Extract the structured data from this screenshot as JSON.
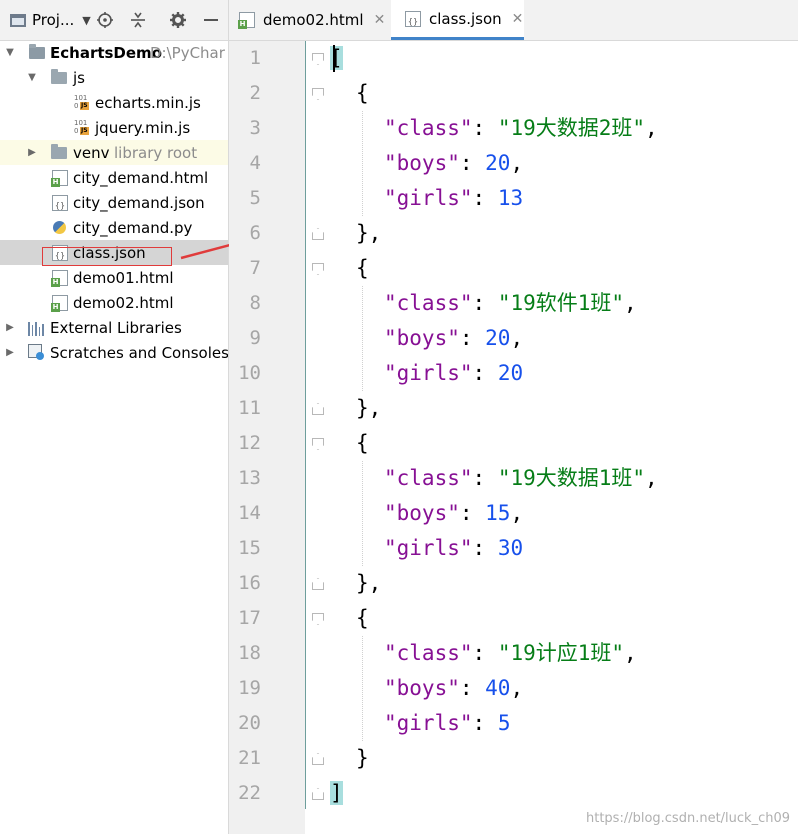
{
  "project_panel": {
    "title": "Proj...",
    "tree": [
      {
        "label": "EchartsDemo",
        "hint": "D:\\PyChar",
        "type": "root-folder",
        "bold": true
      },
      {
        "label": "js",
        "type": "folder"
      },
      {
        "label": "echarts.min.js",
        "type": "js"
      },
      {
        "label": "jquery.min.js",
        "type": "js"
      },
      {
        "label": "venv",
        "hint": "library root",
        "type": "folder"
      },
      {
        "label": "city_demand.html",
        "type": "html"
      },
      {
        "label": "city_demand.json",
        "type": "json"
      },
      {
        "label": "city_demand.py",
        "type": "py"
      },
      {
        "label": "class.json",
        "type": "json",
        "selected": true
      },
      {
        "label": "demo01.html",
        "type": "html"
      },
      {
        "label": "demo02.html",
        "type": "html"
      },
      {
        "label": "External Libraries",
        "type": "libraries"
      },
      {
        "label": "Scratches and Consoles",
        "type": "scratches"
      }
    ]
  },
  "tabs": [
    {
      "label": "demo02.html",
      "icon": "html-file-icon",
      "active": false
    },
    {
      "label": "class.json",
      "icon": "json-file-icon",
      "active": true
    }
  ],
  "editor": {
    "line_numbers": [
      "1",
      "2",
      "3",
      "4",
      "5",
      "6",
      "7",
      "8",
      "9",
      "10",
      "11",
      "12",
      "13",
      "14",
      "15",
      "16",
      "17",
      "18",
      "19",
      "20",
      "21",
      "22"
    ],
    "records": [
      {
        "key_class": "\"class\"",
        "val_class": "\"19大数据2班\"",
        "key_boys": "\"boys\"",
        "val_boys": "20",
        "key_girls": "\"girls\"",
        "val_girls": "13"
      },
      {
        "key_class": "\"class\"",
        "val_class": "\"19软件1班\"",
        "key_boys": "\"boys\"",
        "val_boys": "20",
        "key_girls": "\"girls\"",
        "val_girls": "20"
      },
      {
        "key_class": "\"class\"",
        "val_class": "\"19大数据1班\"",
        "key_boys": "\"boys\"",
        "val_boys": "15",
        "key_girls": "\"girls\"",
        "val_girls": "30"
      },
      {
        "key_class": "\"class\"",
        "val_class": "\"19计应1班\"",
        "key_boys": "\"boys\"",
        "val_boys": "40",
        "key_girls": "\"girls\"",
        "val_girls": "5"
      }
    ]
  },
  "watermark": "https://blog.csdn.net/luck_ch09",
  "colors": {
    "json_key": "#871094",
    "json_string": "#067d17",
    "json_number": "#1750eb",
    "annotation": "#e03b3b",
    "active_tab_underline": "#4083c9"
  }
}
